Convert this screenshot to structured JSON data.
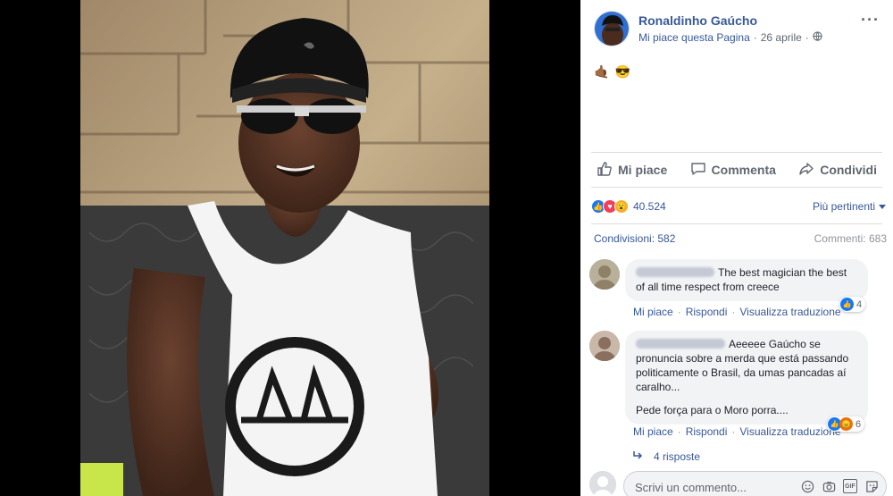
{
  "post": {
    "page_name": "Ronaldinho Gaúcho",
    "like_page_label": "Mi piace questa Pagina",
    "date": "26 aprile",
    "more_label": "···",
    "text_emojis": [
      "🤙🏾",
      "😎"
    ]
  },
  "actions": {
    "like": "Mi piace",
    "comment": "Commenta",
    "share": "Condividi"
  },
  "reactions": {
    "count": "40.524",
    "sort_label": "Più pertinenti"
  },
  "counts": {
    "shares": "Condivisioni: 582",
    "comments": "Commenti: 683"
  },
  "comments": [
    {
      "text": "The best magician the best of all time respect from creece",
      "actions": [
        "Mi piace",
        "Rispondi",
        "Visualizza traduzione"
      ],
      "reaction_count": "4"
    },
    {
      "text": "Aeeeee Gaúcho se pronuncia sobre a merda que está passando politicamente o Brasil, da umas pancadas aí caralho...",
      "text2": "Pede força para o Moro porra....",
      "actions": [
        "Mi piace",
        "Rispondi",
        "Visualizza traduzione"
      ],
      "reaction_count": "6"
    }
  ],
  "replies_label": "4 risposte",
  "composer": {
    "placeholder": "Scrivi un commento..."
  },
  "colors": {
    "link": "#385898",
    "like_blue": "#1877f2",
    "love_red": "#f33e58",
    "wow_yellow": "#f7b125"
  }
}
